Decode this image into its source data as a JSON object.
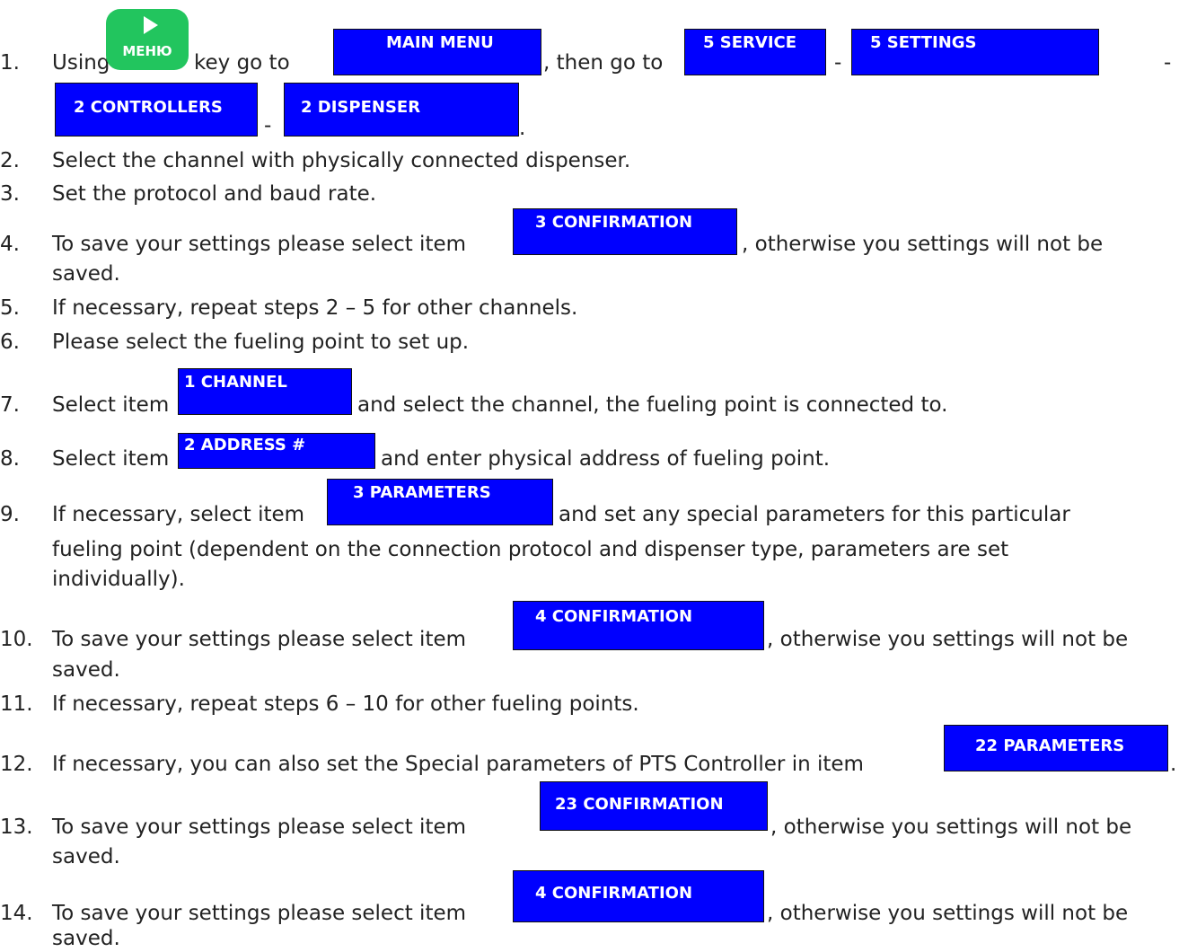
{
  "menu_key": {
    "label": "МЕНЮ",
    "icon": "play-triangle-icon",
    "color": "#22c55e"
  },
  "box_color": "#0000ff",
  "steps": [
    {
      "num": "1.",
      "parts": [
        "Using",
        "key go to",
        ", then go to",
        "-",
        "-",
        "-",
        "."
      ]
    },
    {
      "num": "2.",
      "text": "Select the channel with physically connected dispenser."
    },
    {
      "num": "3.",
      "text": "Set the protocol and baud rate."
    },
    {
      "num": "4.",
      "before": "To save your settings please select item",
      "after": ", otherwise you settings will not be",
      "cont": "saved."
    },
    {
      "num": "5.",
      "text": "If necessary, repeat steps 2 – 5 for other channels."
    },
    {
      "num": "6.",
      "text": "Please select the fueling point to set up."
    },
    {
      "num": "7.",
      "before": "Select item",
      "after": "and select the channel, the fueling point is connected to."
    },
    {
      "num": "8.",
      "before": "Select item",
      "after": "and enter physical address of fueling point."
    },
    {
      "num": "9.",
      "before": "If necessary, select item",
      "after": "and set any special parameters for this particular",
      "cont1": "fueling point (dependent on the connection protocol and dispenser type, parameters are set",
      "cont2": "individually)."
    },
    {
      "num": "10.",
      "before": "To save your settings please select item",
      "after": ", otherwise you settings will not be",
      "cont": "saved."
    },
    {
      "num": "11.",
      "text": "If necessary, repeat steps 6 – 10 for other fueling points."
    },
    {
      "num": "12.",
      "before": "If necessary, you can also set the Special parameters of PTS Controller in item",
      "after": "."
    },
    {
      "num": "13.",
      "before": " To save your settings please select item",
      "after": ", otherwise you settings will not be",
      "cont": "saved."
    },
    {
      "num": "14.",
      "before": "To save your settings please select item",
      "after": ", otherwise you settings will not be",
      "cont": "saved."
    }
  ],
  "boxes": {
    "main_menu": "MAIN MENU",
    "service": "5 SERVICE",
    "settings": "5 SETTINGS",
    "controllers": "2 CONTROLLERS",
    "dispenser": "2 DISPENSER",
    "confirmation_3": "3 CONFIRMATION",
    "channel": "1 CHANNEL",
    "address": "2 ADDRESS #",
    "parameters_3": "3 PARAMETERS",
    "confirmation_4a": "4 CONFIRMATION",
    "parameters_22": "22 PARAMETERS",
    "confirmation_23": "23 CONFIRMATION",
    "confirmation_4b": "4 CONFIRMATION"
  }
}
